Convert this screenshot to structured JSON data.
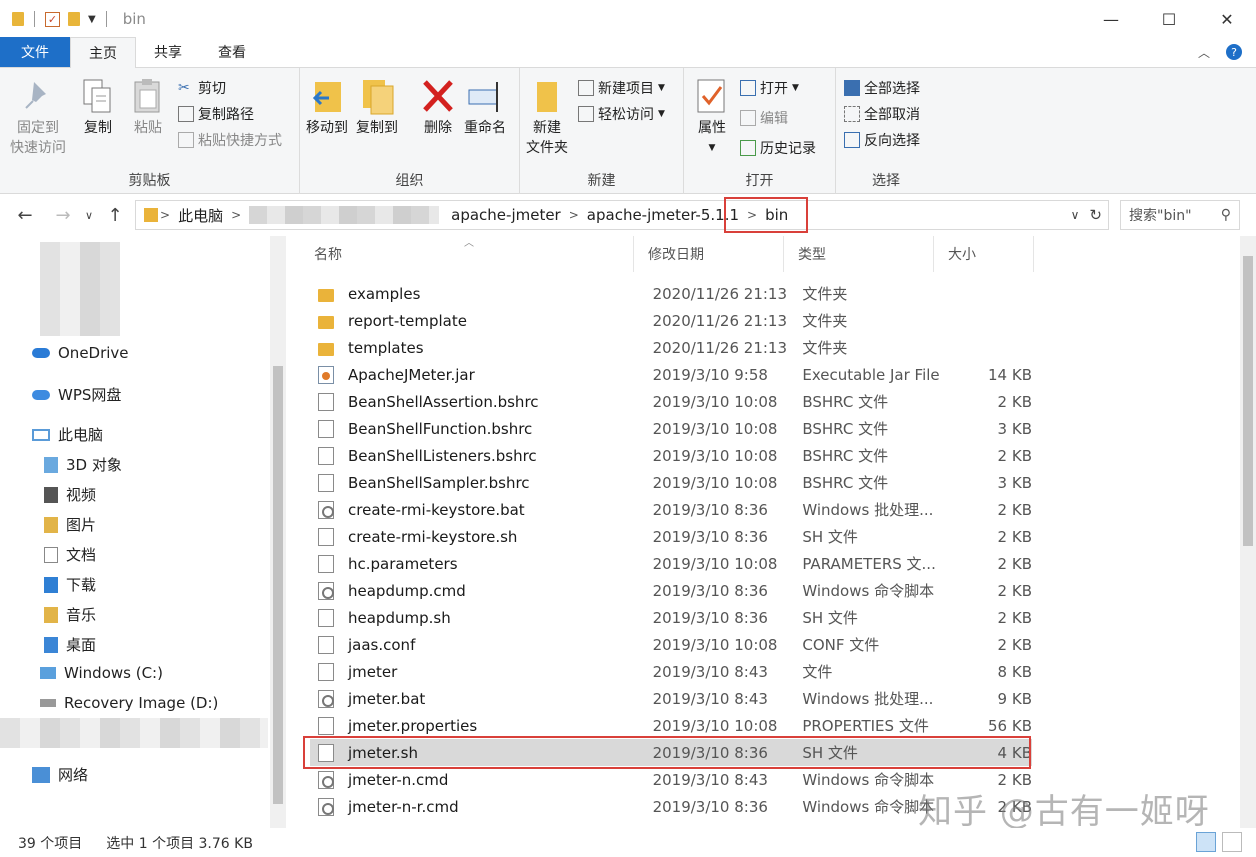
{
  "window": {
    "title": "bin",
    "controls": [
      "—",
      "☐",
      "✕"
    ]
  },
  "tabs": [
    {
      "label": "文件"
    },
    {
      "label": "主页"
    },
    {
      "label": "共享"
    },
    {
      "label": "查看"
    }
  ],
  "ribbon": {
    "clipboard": {
      "label": "剪贴板",
      "pin_line1": "固定到",
      "pin_line2": "快速访问",
      "copy": "复制",
      "paste": "粘贴",
      "cut": "剪切",
      "copy_path": "复制路径",
      "paste_shortcut": "粘贴快捷方式"
    },
    "organize": {
      "label": "组织",
      "move_to": "移动到",
      "copy_to": "复制到",
      "delete": "删除",
      "rename": "重命名"
    },
    "new": {
      "label": "新建",
      "new_folder_line1": "新建",
      "new_folder_line2": "文件夹",
      "new_item": "新建项目",
      "easy_access": "轻松访问"
    },
    "open": {
      "label": "打开",
      "properties": "属性",
      "open": "打开",
      "edit": "编辑",
      "history": "历史记录"
    },
    "select": {
      "label": "选择",
      "select_all": "全部选择",
      "select_none": "全部取消",
      "invert": "反向选择"
    }
  },
  "address": {
    "crumbs": [
      "此电脑",
      "apache-jmeter",
      "apache-jmeter-5.1.1",
      "bin"
    ],
    "search_placeholder": "搜索\"bin\""
  },
  "nav": {
    "items": [
      {
        "label": "OneDrive"
      },
      {
        "label": "WPS网盘"
      },
      {
        "label": "此电脑"
      },
      {
        "label": "3D 对象"
      },
      {
        "label": "视频"
      },
      {
        "label": "图片"
      },
      {
        "label": "文档"
      },
      {
        "label": "下载"
      },
      {
        "label": "音乐"
      },
      {
        "label": "桌面"
      },
      {
        "label": "Windows (C:)"
      },
      {
        "label": "Recovery Image (D:)"
      },
      {
        "label": "网络"
      }
    ]
  },
  "columns": {
    "name": "名称",
    "date": "修改日期",
    "type": "类型",
    "size": "大小"
  },
  "files": [
    {
      "name": "examples",
      "date": "2020/11/26 21:13",
      "type": "文件夹",
      "size": "",
      "kind": "folder"
    },
    {
      "name": "report-template",
      "date": "2020/11/26 21:13",
      "type": "文件夹",
      "size": "",
      "kind": "folder"
    },
    {
      "name": "templates",
      "date": "2020/11/26 21:13",
      "type": "文件夹",
      "size": "",
      "kind": "folder"
    },
    {
      "name": "ApacheJMeter.jar",
      "date": "2019/3/10 9:58",
      "type": "Executable Jar File",
      "size": "14 KB",
      "kind": "jar"
    },
    {
      "name": "BeanShellAssertion.bshrc",
      "date": "2019/3/10 10:08",
      "type": "BSHRC 文件",
      "size": "2 KB",
      "kind": "doc"
    },
    {
      "name": "BeanShellFunction.bshrc",
      "date": "2019/3/10 10:08",
      "type": "BSHRC 文件",
      "size": "3 KB",
      "kind": "doc"
    },
    {
      "name": "BeanShellListeners.bshrc",
      "date": "2019/3/10 10:08",
      "type": "BSHRC 文件",
      "size": "2 KB",
      "kind": "doc"
    },
    {
      "name": "BeanShellSampler.bshrc",
      "date": "2019/3/10 10:08",
      "type": "BSHRC 文件",
      "size": "3 KB",
      "kind": "doc"
    },
    {
      "name": "create-rmi-keystore.bat",
      "date": "2019/3/10 8:36",
      "type": "Windows 批处理...",
      "size": "2 KB",
      "kind": "gear"
    },
    {
      "name": "create-rmi-keystore.sh",
      "date": "2019/3/10 8:36",
      "type": "SH 文件",
      "size": "2 KB",
      "kind": "doc"
    },
    {
      "name": "hc.parameters",
      "date": "2019/3/10 10:08",
      "type": "PARAMETERS 文...",
      "size": "2 KB",
      "kind": "doc"
    },
    {
      "name": "heapdump.cmd",
      "date": "2019/3/10 8:36",
      "type": "Windows 命令脚本",
      "size": "2 KB",
      "kind": "gear"
    },
    {
      "name": "heapdump.sh",
      "date": "2019/3/10 8:36",
      "type": "SH 文件",
      "size": "2 KB",
      "kind": "doc"
    },
    {
      "name": "jaas.conf",
      "date": "2019/3/10 10:08",
      "type": "CONF 文件",
      "size": "2 KB",
      "kind": "doc"
    },
    {
      "name": "jmeter",
      "date": "2019/3/10 8:43",
      "type": "文件",
      "size": "8 KB",
      "kind": "doc"
    },
    {
      "name": "jmeter.bat",
      "date": "2019/3/10 8:43",
      "type": "Windows 批处理...",
      "size": "9 KB",
      "kind": "gear"
    },
    {
      "name": "jmeter.properties",
      "date": "2019/3/10 10:08",
      "type": "PROPERTIES 文件",
      "size": "56 KB",
      "kind": "doc"
    },
    {
      "name": "jmeter.sh",
      "date": "2019/3/10 8:36",
      "type": "SH 文件",
      "size": "4 KB",
      "kind": "doc"
    },
    {
      "name": "jmeter-n.cmd",
      "date": "2019/3/10 8:43",
      "type": "Windows 命令脚本",
      "size": "2 KB",
      "kind": "gear"
    },
    {
      "name": "jmeter-n-r.cmd",
      "date": "2019/3/10 8:36",
      "type": "Windows 命令脚本",
      "size": "2 KB",
      "kind": "gear"
    }
  ],
  "watermark": "知乎 @古有一姬呀",
  "status": {
    "count": "39 个项目",
    "selected": "选中 1 个项目  3.76 KB"
  }
}
